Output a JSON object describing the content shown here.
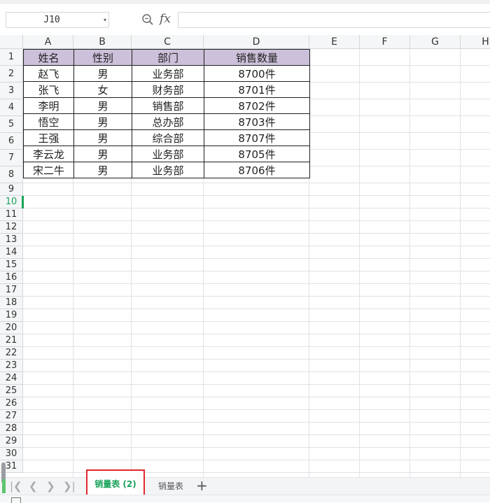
{
  "formula_bar": {
    "cell_ref": "J10",
    "fx_label": "fx",
    "formula_value": ""
  },
  "columns": [
    "A",
    "B",
    "C",
    "D",
    "E",
    "F",
    "G",
    "H"
  ],
  "rows": [
    "1",
    "2",
    "3",
    "4",
    "5",
    "6",
    "7",
    "8",
    "9",
    "10",
    "11",
    "12",
    "13",
    "14",
    "15",
    "16",
    "17",
    "18",
    "19",
    "20",
    "21",
    "22",
    "23",
    "24",
    "25",
    "26",
    "27",
    "28",
    "29",
    "30",
    "31"
  ],
  "active_row": "10",
  "table": {
    "headers": [
      "姓名",
      "性别",
      "部门",
      "销售数量"
    ],
    "rows": [
      [
        "赵飞",
        "男",
        "业务部",
        "8700件"
      ],
      [
        "张飞",
        "女",
        "财务部",
        "8701件"
      ],
      [
        "李明",
        "男",
        "销售部",
        "8702件"
      ],
      [
        "悟空",
        "男",
        "总办部",
        "8703件"
      ],
      [
        "王强",
        "男",
        "综合部",
        "8707件"
      ],
      [
        "李云龙",
        "男",
        "业务部",
        "8705件"
      ],
      [
        "宋二牛",
        "男",
        "业务部",
        "8706件"
      ]
    ]
  },
  "sheet_tabs": {
    "active": "销量表 (2)",
    "inactive": "销量表",
    "add_label": "+"
  },
  "colors": {
    "header_fill": "#ccc0da",
    "accent_green": "#1aa35a",
    "highlight_red": "#e0282e"
  }
}
